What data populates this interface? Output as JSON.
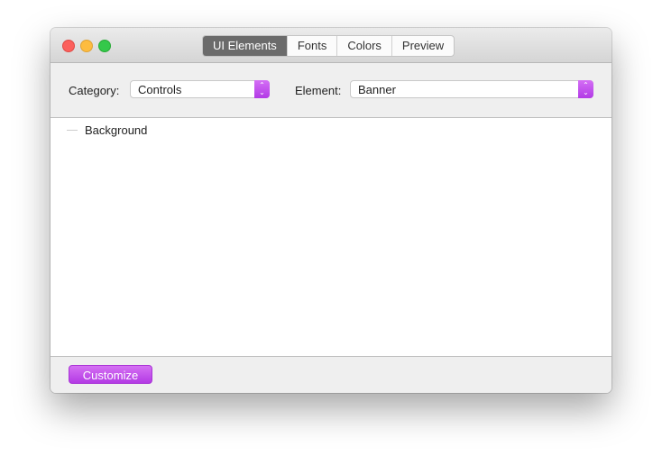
{
  "window": {
    "tabs": [
      {
        "label": "UI Elements",
        "active": true
      },
      {
        "label": "Fonts",
        "active": false
      },
      {
        "label": "Colors",
        "active": false
      },
      {
        "label": "Preview",
        "active": false
      }
    ]
  },
  "toolbar": {
    "category_label": "Category:",
    "category_value": "Controls",
    "element_label": "Element:",
    "element_value": "Banner"
  },
  "list": {
    "items": [
      {
        "label": "Background"
      }
    ]
  },
  "footer": {
    "customize_label": "Customize"
  },
  "colors": {
    "accent": "#c04fec",
    "close": "#fc605c",
    "minimize": "#fdbc40",
    "zoom": "#34c84a"
  }
}
